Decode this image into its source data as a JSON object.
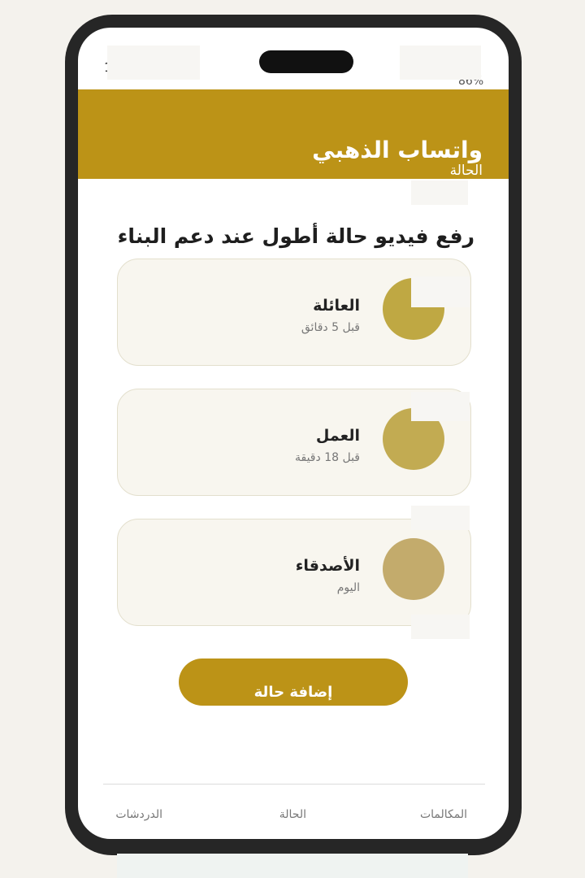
{
  "status_bar": {
    "time": "1",
    "battery": "86%"
  },
  "header": {
    "title": "واتساب الذهبي",
    "subtitle": "الحالة"
  },
  "banner": {
    "text": "رفع فيديو حالة أطول عند دعم البناء"
  },
  "statuses": [
    {
      "name": "العائلة",
      "time": "قبل 5 دقائق",
      "avatar_color": "#bfa843"
    },
    {
      "name": "العمل",
      "time": "قبل 18 دقيقة",
      "avatar_color": "#c2ab52"
    },
    {
      "name": "الأصدقاء",
      "time": "اليوم",
      "avatar_color": "#c3ab6c"
    }
  ],
  "add_button": {
    "label": "إضافة حالة"
  },
  "bottom_nav": [
    {
      "label": "المكالمات"
    },
    {
      "label": "الحالة"
    },
    {
      "label": "الدردشات"
    }
  ],
  "colors": {
    "accent": "#bc9317",
    "phone_frame": "#262626",
    "card_background": "#f8f6ef",
    "card_border": "#e3dfcd"
  }
}
